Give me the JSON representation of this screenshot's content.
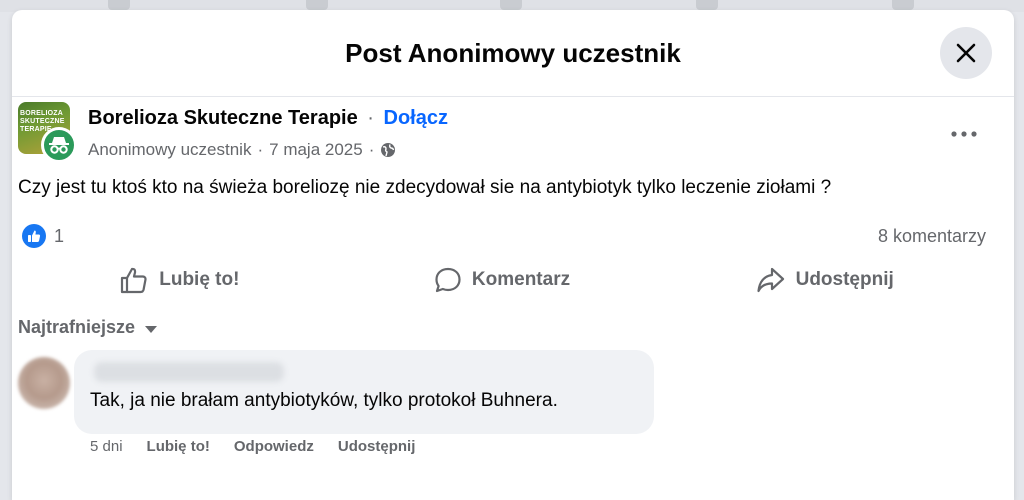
{
  "modal": {
    "title": "Post Anonimowy uczestnik"
  },
  "post": {
    "group_name": "Borelioza Skuteczne Terapie",
    "separator": "·",
    "join_label": "Dołącz",
    "avatar_text": "BORELIOZA SKUTECZNE TERAPIE",
    "author": "Anonimowy uczestnik",
    "date": "7 maja 2025",
    "privacy_icon": "globe-icon",
    "text": "Czy jest tu ktoś kto na świeża boreliozę nie zdecydował sie na antybiotyk tylko leczenie ziołami ?",
    "like_count": "1",
    "comment_count": "8 komentarzy"
  },
  "actions": {
    "like_label": "Lubię to!",
    "comment_label": "Komentarz",
    "share_label": "Udostępnij"
  },
  "comments": {
    "sort_label": "Najtrafniejsze",
    "items": [
      {
        "text": "Tak, ja nie brałam antybiotyków, tylko protokoł Buhnera.",
        "time": "5 dni",
        "like": "Lubię to!",
        "reply": "Odpowiedz",
        "share": "Udostępnij"
      }
    ]
  },
  "colors": {
    "accent": "#0866ff",
    "like_blue": "#1877f2",
    "anon_green": "#2b9a5a",
    "secondary_text": "#65676b",
    "bubble": "#f0f2f5"
  }
}
